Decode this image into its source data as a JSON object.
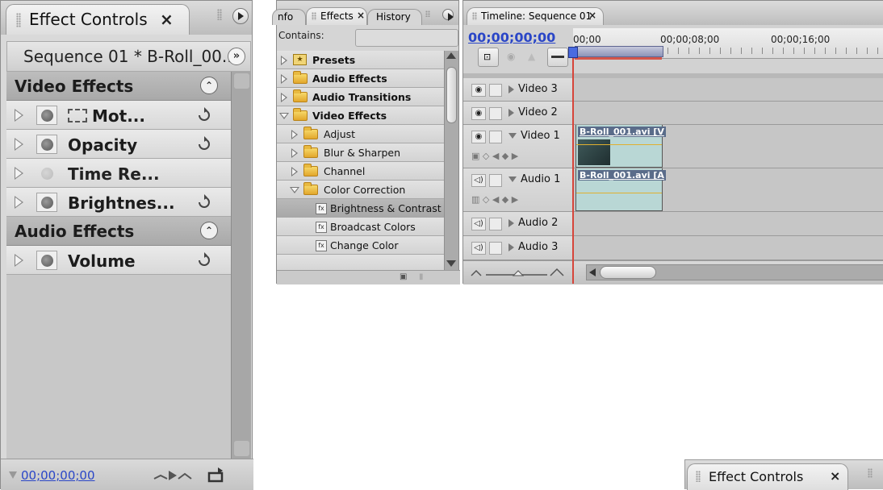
{
  "effect_controls": {
    "tab_label": "Effect Controls",
    "close": "×",
    "sequence_label": "Sequence 01 * B-Roll_00...",
    "sections": [
      {
        "label": "Video Effects",
        "items": [
          {
            "label": "Mot...",
            "reset": true
          },
          {
            "label": "Opacity",
            "reset": true
          },
          {
            "label": "Time Re...",
            "reset": false
          },
          {
            "label": "Brightnes...",
            "reset": true
          }
        ]
      },
      {
        "label": "Audio Effects",
        "items": [
          {
            "label": "Volume",
            "reset": true
          }
        ]
      }
    ],
    "timecode": "00;00;00;00"
  },
  "effects_panel": {
    "tabs": [
      "nfo",
      "Effects",
      "History"
    ],
    "close": "×",
    "contains_label": "Contains:",
    "tree": [
      {
        "label": "Presets",
        "level": 0,
        "type": "preset",
        "open": false,
        "bold": true
      },
      {
        "label": "Audio Effects",
        "level": 0,
        "type": "folder",
        "open": false,
        "bold": true
      },
      {
        "label": "Audio Transitions",
        "level": 0,
        "type": "folder",
        "open": false,
        "bold": true
      },
      {
        "label": "Video Effects",
        "level": 0,
        "type": "folder",
        "open": true,
        "bold": true
      },
      {
        "label": "Adjust",
        "level": 1,
        "type": "folder",
        "open": false,
        "bold": false
      },
      {
        "label": "Blur & Sharpen",
        "level": 1,
        "type": "folder",
        "open": false,
        "bold": false
      },
      {
        "label": "Channel",
        "level": 1,
        "type": "folder",
        "open": false,
        "bold": false
      },
      {
        "label": "Color Correction",
        "level": 1,
        "type": "folder",
        "open": true,
        "bold": false
      },
      {
        "label": "Brightness & Contrast",
        "level": 2,
        "type": "effect",
        "selected": true,
        "bold": false
      },
      {
        "label": "Broadcast Colors",
        "level": 2,
        "type": "effect",
        "bold": false
      },
      {
        "label": "Change Color",
        "level": 2,
        "type": "effect",
        "bold": false
      }
    ]
  },
  "timeline": {
    "tab_label": "Timeline: Sequence 01",
    "close": "×",
    "timecode": "00;00;00;00",
    "ruler_labels": [
      "00;00",
      "00;00;08;00",
      "00;00;16;00"
    ],
    "tracks": [
      {
        "name": "Video 3",
        "kind": "video",
        "open": false
      },
      {
        "name": "Video 2",
        "kind": "video",
        "open": false
      },
      {
        "name": "Video 1",
        "kind": "video",
        "open": true,
        "clip": "B-Roll_001.avi [V"
      },
      {
        "name": "Audio 1",
        "kind": "audio",
        "open": true,
        "clip": "B-Roll_001.avi [A"
      },
      {
        "name": "Audio 2",
        "kind": "audio",
        "open": false
      },
      {
        "name": "Audio 3",
        "kind": "audio",
        "open": false
      }
    ]
  },
  "mini_tab": {
    "label": "Effect Controls",
    "close": "×"
  },
  "colors": {
    "timecode": "#2a46c7",
    "playhead": "#d6453a",
    "selection": "#aaaaaa"
  }
}
